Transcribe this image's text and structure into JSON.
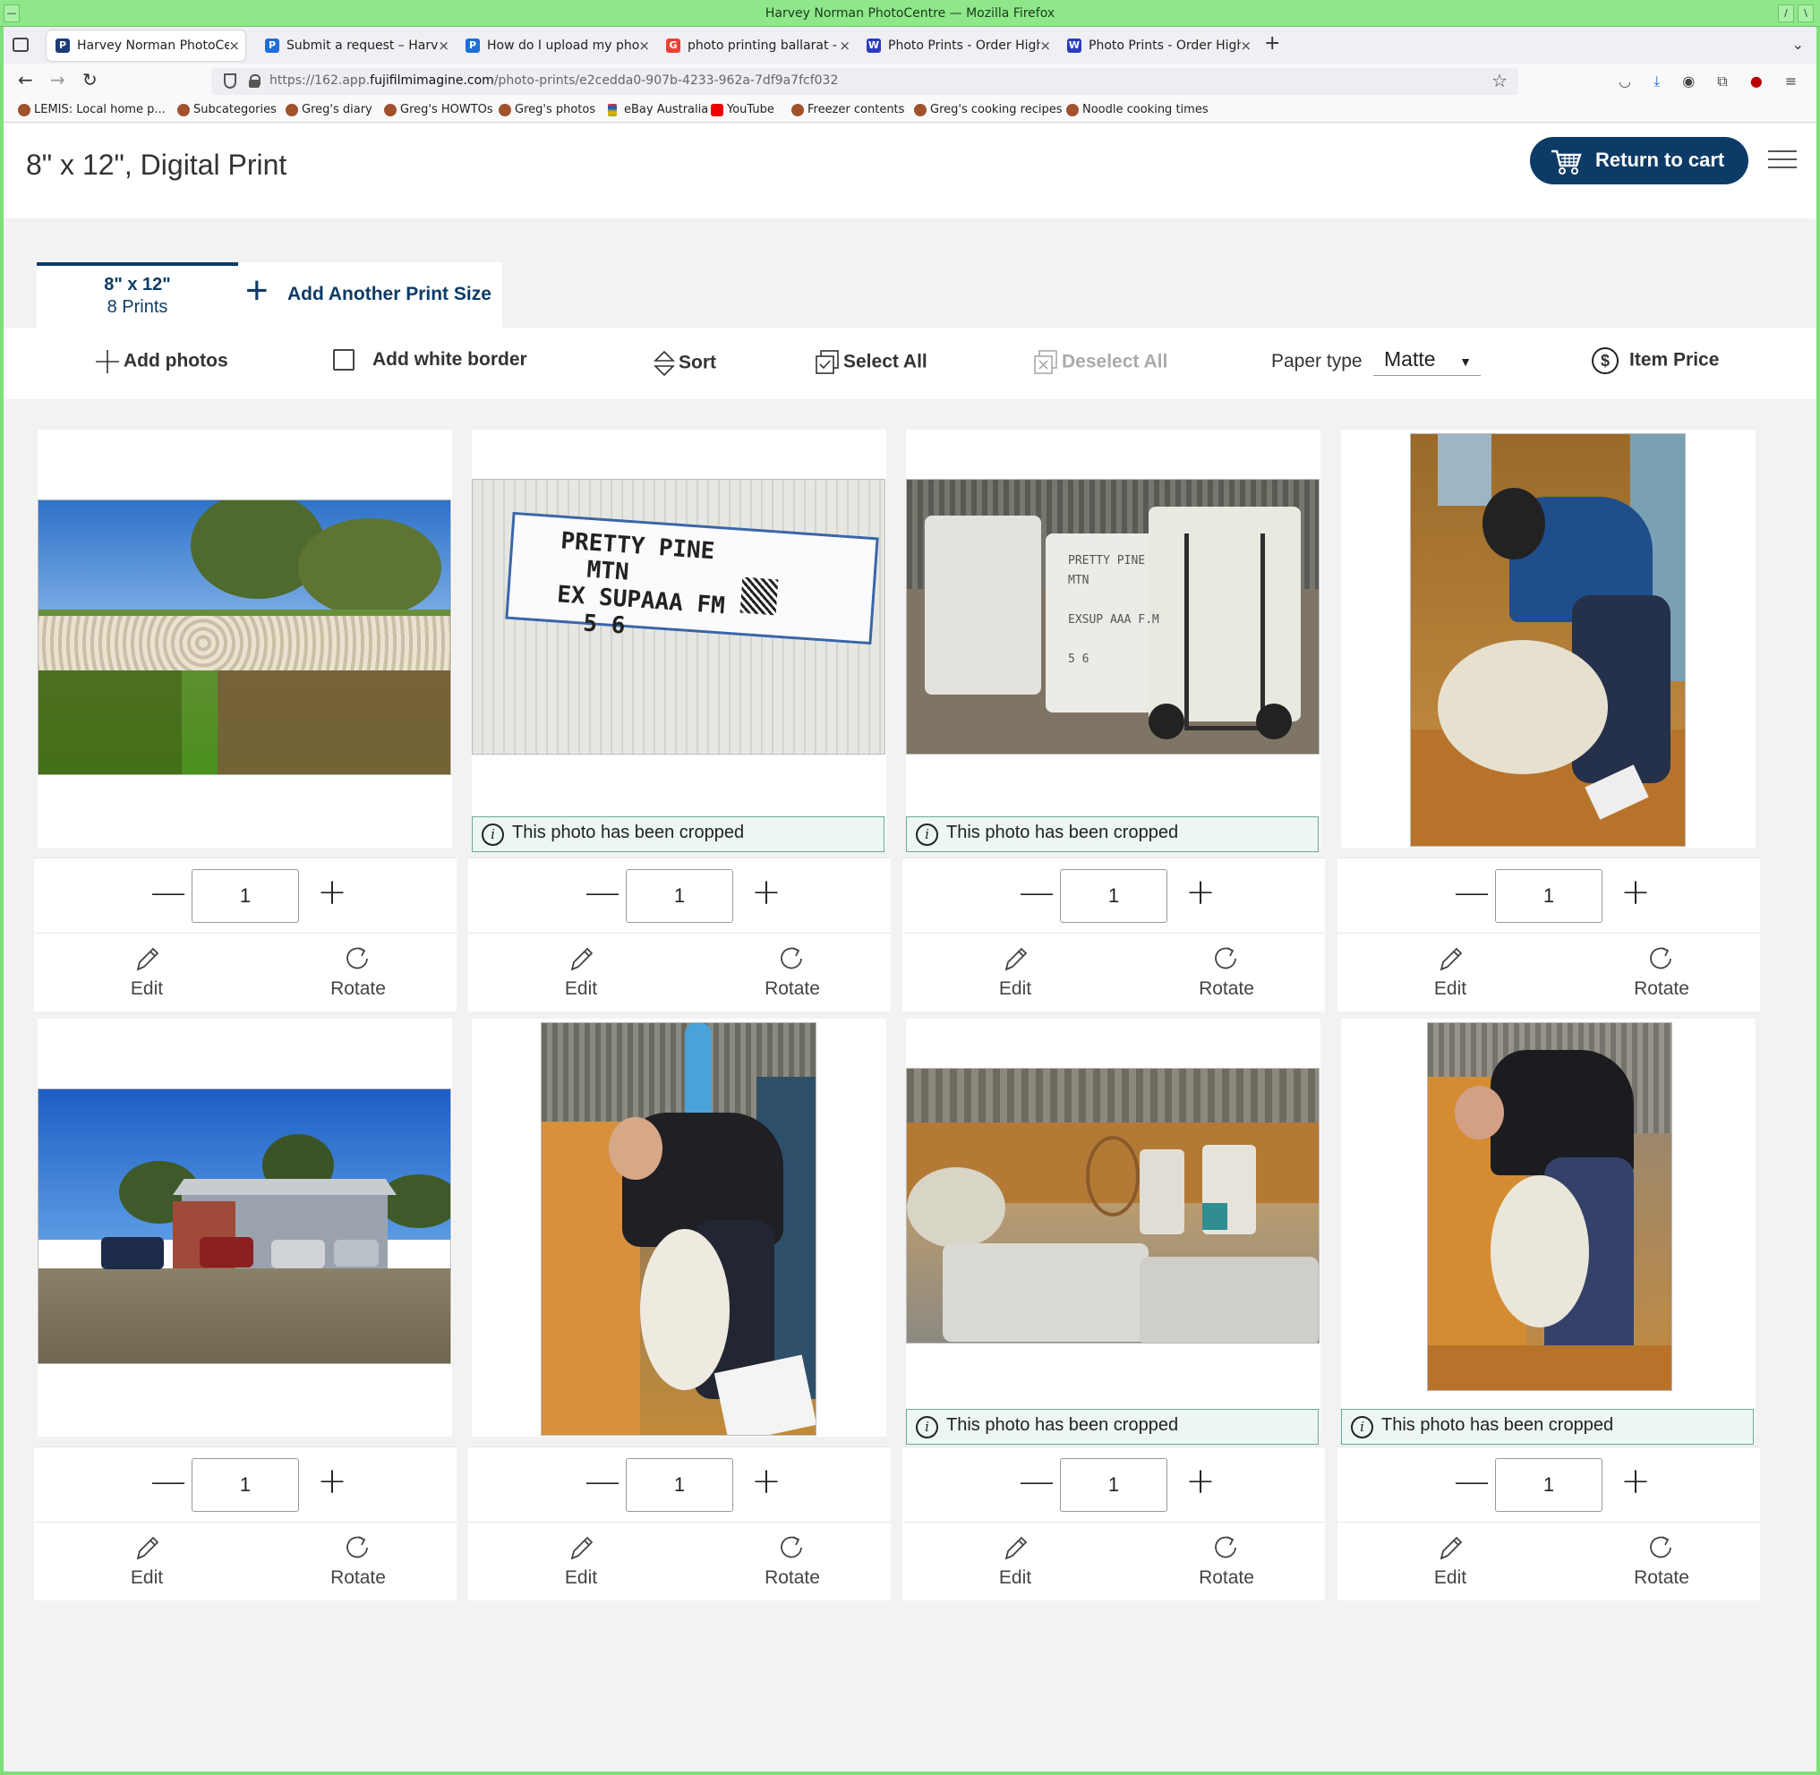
{
  "window": {
    "title": "Harvey Norman PhotoCentre — Mozilla Firefox"
  },
  "tabs": [
    {
      "label": "Harvey Norman PhotoCen",
      "favicon": "P",
      "color": "#1e3c78",
      "active": true
    },
    {
      "label": "Submit a request – Harvey",
      "favicon": "P",
      "color": "#1e6fd6",
      "active": false
    },
    {
      "label": "How do I upload my photo",
      "favicon": "P",
      "color": "#1e6fd6",
      "active": false
    },
    {
      "label": "photo printing ballarat - G",
      "favicon": "G",
      "color": "#ea4335",
      "active": false
    },
    {
      "label": "Photo Prints - Order High-",
      "favicon": "W",
      "color": "#2b3dbf",
      "active": false
    },
    {
      "label": "Photo Prints - Order High-",
      "favicon": "W",
      "color": "#2b3dbf",
      "active": false
    }
  ],
  "address": {
    "prefix": "https://162.app.",
    "domain": "fujifilmimagine.com",
    "path": "/photo-prints/e2cedda0-907b-4233-962a-7df9a7fcf032"
  },
  "bookmarks": [
    "LEMIS: Local home p...",
    "Subcategories",
    "Greg's diary",
    "Greg's HOWTOs",
    "Greg's photos",
    "eBay Australia",
    "YouTube",
    "Freezer contents",
    "Greg's cooking recipes",
    "Noodle cooking times"
  ],
  "header": {
    "title": "8\" x 12\", Digital Print",
    "cart_button": "Return to cart"
  },
  "size_tabs": {
    "active_size": "8\" x 12\"",
    "active_count": "8 Prints",
    "add_label": "Add Another Print Size"
  },
  "toolbar": {
    "add_photos": "Add photos",
    "white_border": "Add white border",
    "sort": "Sort",
    "select_all": "Select All",
    "deselect_all": "Deselect All",
    "paper_type_label": "Paper type",
    "paper_type_value": "Matte",
    "item_price": "Item Price"
  },
  "photos": [
    {
      "scene": "sheep-paddock",
      "cropped": false,
      "quantity": "1"
    },
    {
      "scene": "wool-bale-label",
      "cropped": true,
      "quantity": "1"
    },
    {
      "scene": "wool-bales-trolley",
      "cropped": true,
      "quantity": "1"
    },
    {
      "scene": "shearer-blue-shirt",
      "cropped": false,
      "quantity": "1"
    },
    {
      "scene": "shearing-shed-cars",
      "cropped": false,
      "quantity": "1"
    },
    {
      "scene": "shearer-bald",
      "cropped": false,
      "quantity": "1"
    },
    {
      "scene": "shed-interior-bales",
      "cropped": true,
      "quantity": "1"
    },
    {
      "scene": "shearer-black-shirt",
      "cropped": true,
      "quantity": "1"
    }
  ],
  "labels": {
    "cropped": "This photo has been cropped",
    "edit": "Edit",
    "rotate": "Rotate"
  },
  "colors": {
    "brand_navy": "#0c3b67",
    "crop_note_bg": "#ecf6f2",
    "crop_note_border": "#6aab94"
  }
}
